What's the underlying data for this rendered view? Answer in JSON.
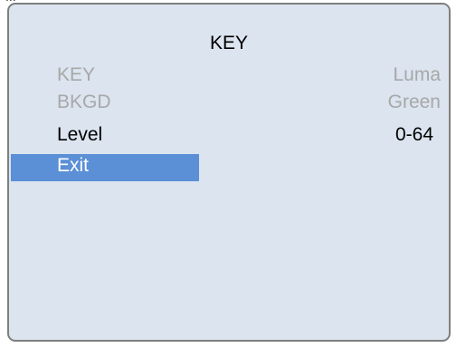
{
  "top_clip_text": "...",
  "menu": {
    "title": "KEY",
    "items": [
      {
        "label": "KEY",
        "value": "Luma",
        "state": "disabled"
      },
      {
        "label": "BKGD",
        "value": "Green",
        "state": "disabled"
      },
      {
        "label": "Level",
        "value": "0-64",
        "state": "enabled"
      },
      {
        "label": "Exit",
        "value": "",
        "state": "selected"
      }
    ]
  },
  "colors": {
    "panel_background": "#dbe4ef",
    "panel_border": "#7f7f7f",
    "selection": "#5b8fd6",
    "disabled_text": "#a8a8a8",
    "enabled_text": "#000000",
    "selected_text": "#ffffff"
  }
}
